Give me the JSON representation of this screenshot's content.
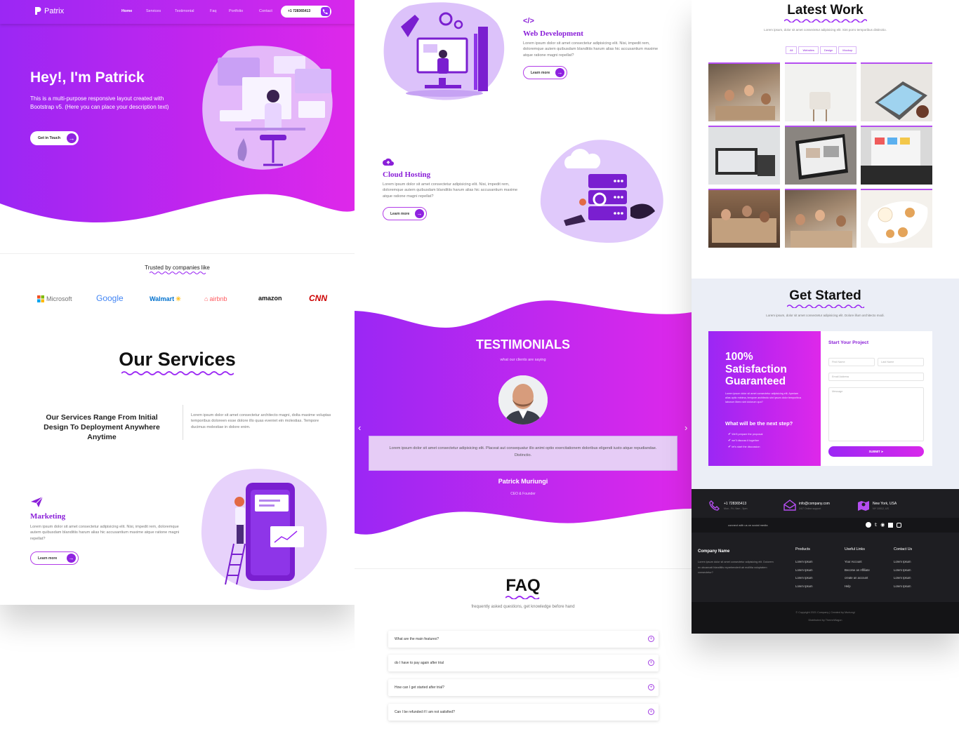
{
  "brand": {
    "name": "Patrix",
    "accent": "#9b27f4",
    "accent2": "#de28ea"
  },
  "nav": {
    "items": [
      "Home",
      "Services",
      "Testimonial",
      "Faq",
      "Portfolio",
      "Contact"
    ],
    "phone": "+1 728365413"
  },
  "hero": {
    "title": "Hey!, I'm Patrick",
    "text": "This is a multi-purpose responsive layout created with Bootstrap v5. (Here you can place your description text)",
    "cta": "Get in Touch"
  },
  "trusted": {
    "title": "Trusted by companies like",
    "logos": [
      "Microsoft",
      "Google",
      "Walmart",
      "airbnb",
      "amazon",
      "CNN"
    ]
  },
  "services": {
    "title": "Our Services",
    "range_text": "Our Services Range From Initial Design To Deployment Anywhere Anytime",
    "range_desc": "Lorem ipsum dolor sit amet consectetur architecto magni, dolta maxime voluptas temporibus doloreen esse dolore illo quas eveniet ein molestias. Tempore ducimus molestiae in dolore enim.",
    "items": [
      {
        "title": "Marketing",
        "text": "Lorem ipsum dolor sit amet consectetur adipisicing elit. Nisi, impedit rem, doloremque autem quibusdam blanditiis harum alias hic accusantium maxime atque ratione magni repellat?",
        "button": "Learn more"
      },
      {
        "title": "Web Development",
        "text": "Lorem ipsum dolor sit amet consectetur adipisicing elit. Nisi, impedit rem, doloremque autem quibusdam blanditiis harum alias hic accusantium maxime atque ratione magni repellat?",
        "button": "Learn more"
      },
      {
        "title": "Cloud Hosting",
        "text": "Lorem ipsum dolor sit amet consectetur adipisicing elit. Nisi, impedit rem, doloremque autem quibusdam blanditiis harum alias hic accusantium maxime atque ratione magni repellat?",
        "button": "Learn more"
      }
    ]
  },
  "testimonials": {
    "title": "TESTIMONIALS",
    "subtitle": "what our clients are saying",
    "quote": "Lorem ipsum dolor sit amet consectetur adipisicing elit. Placeat aut consequatur illo animi optio exercitationem doloribus eligendi iusto atque repudiandae. Distinctio.",
    "name": "Patrick Muriungi",
    "role": "CEO & Founder",
    "prev": "‹",
    "next": "›"
  },
  "faq": {
    "title": "FAQ",
    "subtitle": "frequently asked questions, get knowledge before hand",
    "items": [
      "What are the main features?",
      "do I have to pay again after trial",
      "How can I get started after trial?",
      "Can I be refunded if I am not satisfied?"
    ]
  },
  "work": {
    "title": "Latest Work",
    "subtitle": "Lorem ipsum, dolor sit amet consectetur adipisicing elit. Sint porro temporibus distinctio.",
    "filters": [
      "All",
      "Websites",
      "Design",
      "Mockup"
    ]
  },
  "started": {
    "title": "Get Started",
    "subtitle": "Lorem ipsum, dolor sit amet consectetur adipisicing elit. Dolore illum architecto modi.",
    "guarantee": "100% Satisfaction Guaranteed",
    "guarantee_text": "Lorem ipsum dolor sit amet consectetur adipisicing elit. Aperiam alias optio minima, tempore architecto sint ipsum dolor temporibus laborum libero sint dolorum quo?",
    "next_title": "What will be the next step?",
    "steps": [
      "We'll prepare the proposal",
      "we'll discuss it together",
      "let's start the discussion"
    ],
    "form_title": "Start Your Project",
    "first": "First Name",
    "last": "Last Name",
    "email": "Email Address",
    "message": "Message",
    "submit": "SUBMIT"
  },
  "contacts": [
    {
      "icon": "phone-icon",
      "line1": "+1 728365413",
      "line2": "Mon - Fri, 9am - 5pm"
    },
    {
      "icon": "envelope-icon",
      "line1": "info@company.com",
      "line2": "24/7 Online support"
    },
    {
      "icon": "map-icon",
      "line1": "New York, USA",
      "line2": "NY 10012, US"
    }
  ],
  "footer": {
    "social_text": "connect with us on social media",
    "company": "Company Name",
    "company_text": "Lorem ipsum dolor sit amet consectetur adipisicing elit. Dolorem ex obcaecati blanditiis reprehenderit ab mollitia voluptatem consectetur?",
    "cols": [
      {
        "title": "Products",
        "links": [
          "Lorem Ipsum",
          "Lorem Ipsum",
          "Lorem Ipsum",
          "Lorem Ipsum"
        ]
      },
      {
        "title": "Useful Links",
        "links": [
          "Your Account",
          "Become an Affiliate",
          "create an account",
          "Help"
        ]
      },
      {
        "title": "Contact Us",
        "links": [
          "Lorem Ipsum",
          "Lorem Ipsum",
          "Lorem Ipsum",
          "Lorem Ipsum"
        ]
      }
    ],
    "copyright": "© Copyright 2021 Company | Created by Muriungi",
    "distributed": "Distributed by ThemeWagon"
  }
}
